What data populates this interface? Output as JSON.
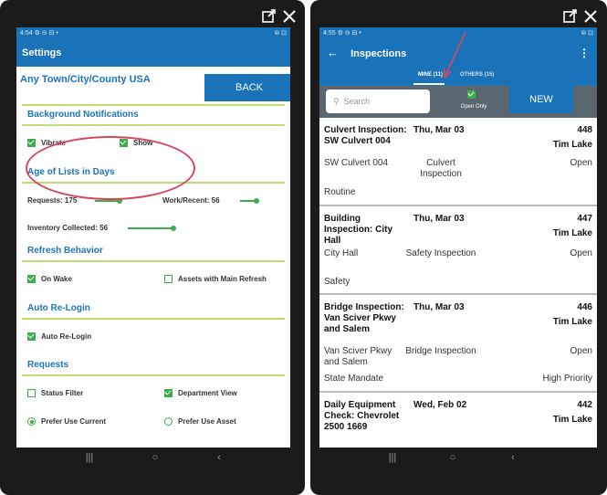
{
  "settings_screen": {
    "status_time": "4:54",
    "status_icons": "⚙ ⊝ ⊟ •",
    "status_right": "⊜ ⊡",
    "title": "Settings",
    "town": "Any Town/City/County USA",
    "back_label": "BACK",
    "sections": {
      "background": {
        "title": "Background Notifications",
        "vibrate": "Vibrate",
        "vibrate_checked": true,
        "show": "Show",
        "show_checked": true
      },
      "age": {
        "title": "Age of Lists in Days",
        "requests_label": "Requests:",
        "requests_value": "175",
        "work_label": "Work/Recent:",
        "work_value": "56",
        "inventory_label": "Inventory Collected:",
        "inventory_value": "56"
      },
      "refresh": {
        "title": "Refresh Behavior",
        "on_wake": "On Wake",
        "on_wake_checked": true,
        "assets": "Assets with Main Refresh",
        "assets_checked": false
      },
      "relogin": {
        "title": "Auto Re-Login",
        "auto": "Auto Re-Login",
        "auto_checked": true
      },
      "requests": {
        "title": "Requests",
        "status_filter": "Status Filter",
        "status_filter_checked": false,
        "department_view": "Department View",
        "department_view_checked": true,
        "prefer_current": "Prefer Use Current",
        "prefer_current_selected": true,
        "prefer_asset": "Prefer Use Asset",
        "prefer_asset_selected": false
      }
    }
  },
  "inspections_screen": {
    "status_time": "4:55",
    "status_icons": "⚙ ⊝ ⊟ •",
    "status_right": "⊜ ⊡",
    "title": "Inspections",
    "tab_mine": "MINE (11)",
    "tab_others": "OTHERS (15)",
    "search_placeholder": "Search",
    "open_only": "Open Only",
    "new_label": "NEW",
    "items": [
      {
        "title": "Culvert Inspection: SW Culvert 004",
        "date": "Thu, Mar 03",
        "number": "448",
        "inspector": "Tim Lake",
        "location": "SW Culvert 004",
        "type": "Culvert Inspection",
        "status": "Open",
        "category": "Routine",
        "priority": ""
      },
      {
        "title": "Building Inspection: City Hall",
        "date": "Thu, Mar 03",
        "number": "447",
        "inspector": "Tim Lake",
        "location": "City Hall",
        "type": "Safety Inspection",
        "status": "Open",
        "category": "Safety",
        "priority": ""
      },
      {
        "title": "Bridge Inspection: Van Sciver Pkwy and Salem",
        "date": "Thu, Mar 03",
        "number": "446",
        "inspector": "Tim Lake",
        "location": "Van Sciver Pkwy and Salem",
        "type": "Bridge Inspection",
        "status": "Open",
        "category": "State Mandate",
        "priority": "High Priority"
      },
      {
        "title": "Daily Equipment Check: Chevrolet 2500 1669",
        "date": "Wed, Feb 02",
        "number": "442",
        "inspector": "Tim Lake",
        "location": "",
        "type": "",
        "status": "",
        "category": "",
        "priority": ""
      }
    ]
  },
  "colors": {
    "appbar": "#1a73b8",
    "accent_green": "#3dad4a",
    "section_line": "#c0dd74",
    "annotation": "#d5475f"
  }
}
